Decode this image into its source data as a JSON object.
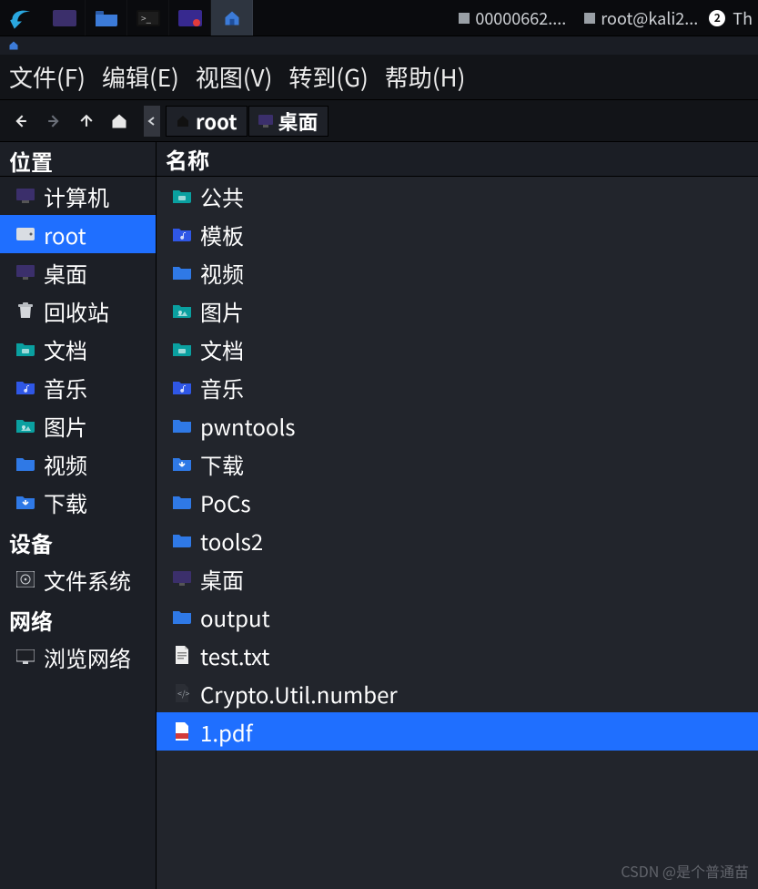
{
  "taskbar": {
    "windows": [
      {
        "icon": "square",
        "label": "00000662...."
      },
      {
        "icon": "square",
        "label": "root@kali2..."
      },
      {
        "icon": "none",
        "label": "Th"
      }
    ],
    "badge": "2"
  },
  "menubar": {
    "items": [
      "文件(F)",
      "编辑(E)",
      "视图(V)",
      "转到(G)",
      "帮助(H)"
    ]
  },
  "path": {
    "segments": [
      "root",
      "桌面"
    ]
  },
  "sidebar": {
    "head": "位置",
    "places": [
      {
        "label": "计算机",
        "icon": "computer",
        "selected": false
      },
      {
        "label": "root",
        "icon": "drive",
        "selected": true
      },
      {
        "label": "桌面",
        "icon": "desktop",
        "selected": false
      },
      {
        "label": "回收站",
        "icon": "trash",
        "selected": false
      },
      {
        "label": "文档",
        "icon": "folder-teal",
        "selected": false
      },
      {
        "label": "音乐",
        "icon": "folder-music",
        "selected": false
      },
      {
        "label": "图片",
        "icon": "folder-pic",
        "selected": false
      },
      {
        "label": "视频",
        "icon": "folder-blue",
        "selected": false
      },
      {
        "label": "下载",
        "icon": "folder-down",
        "selected": false
      }
    ],
    "devices_title": "设备",
    "devices": [
      {
        "label": "文件系统",
        "icon": "disk"
      }
    ],
    "network_title": "网络",
    "network": [
      {
        "label": "浏览网络",
        "icon": "net"
      }
    ]
  },
  "files": {
    "head": "名称",
    "items": [
      {
        "label": "公共",
        "icon": "folder-teal"
      },
      {
        "label": "模板",
        "icon": "folder-music"
      },
      {
        "label": "视频",
        "icon": "folder-blue"
      },
      {
        "label": "图片",
        "icon": "folder-pic"
      },
      {
        "label": "文档",
        "icon": "folder-teal"
      },
      {
        "label": "音乐",
        "icon": "folder-music"
      },
      {
        "label": "pwntools",
        "icon": "folder"
      },
      {
        "label": "下载",
        "icon": "folder-down"
      },
      {
        "label": "PoCs",
        "icon": "folder"
      },
      {
        "label": "tools2",
        "icon": "folder"
      },
      {
        "label": "桌面",
        "icon": "desktop"
      },
      {
        "label": "output",
        "icon": "folder"
      },
      {
        "label": "test.txt",
        "icon": "text-file"
      },
      {
        "label": "Crypto.Util.number",
        "icon": "code-file"
      },
      {
        "label": "1.pdf",
        "icon": "pdf-file",
        "selected": true
      }
    ]
  },
  "watermark": "CSDN @是个普通苗"
}
